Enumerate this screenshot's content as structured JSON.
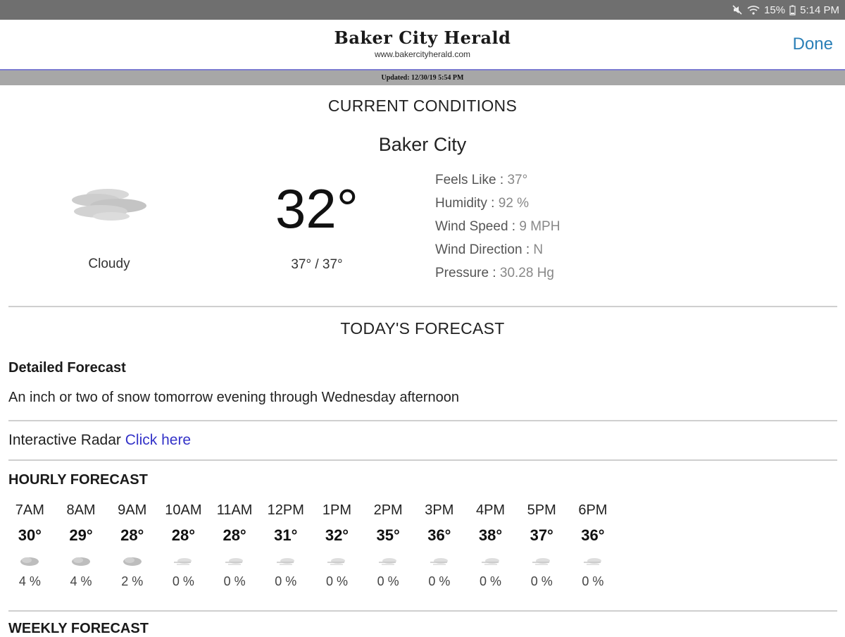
{
  "status_bar": {
    "battery": "15%",
    "time": "5:14 PM",
    "icons": [
      "mute-icon",
      "wifi-icon",
      "battery-icon"
    ]
  },
  "header": {
    "masthead": "Baker City Herald",
    "url": "www.bakercityherald.com",
    "done_label": "Done",
    "updated": "Updated: 12/30/19 5:54 PM"
  },
  "current": {
    "section_title": "CURRENT CONDITIONS",
    "city": "Baker City",
    "condition": "Cloudy",
    "condition_icon": "cloudy-icon",
    "temperature": "32°",
    "hi_lo": "37° / 37°",
    "details": [
      {
        "label": "Feels Like : ",
        "value": "37°"
      },
      {
        "label": "Humidity : ",
        "value": "92 %"
      },
      {
        "label": "Wind Speed : ",
        "value": "9 MPH"
      },
      {
        "label": "Wind Direction : ",
        "value": "N"
      },
      {
        "label": "Pressure : ",
        "value": "30.28 Hg"
      }
    ]
  },
  "today": {
    "section_title": "TODAY'S FORECAST",
    "detailed_label": "Detailed Forecast",
    "detailed_text": "An inch or two of snow tomorrow evening through Wednesday afternoon",
    "radar_label": "Interactive Radar ",
    "radar_link": "Click here"
  },
  "hourly": {
    "title": "HOURLY FORECAST",
    "hours": [
      {
        "time": "7AM",
        "temp": "30°",
        "pop": "4 %",
        "icon": "cloudy-icon"
      },
      {
        "time": "8AM",
        "temp": "29°",
        "pop": "4 %",
        "icon": "cloudy-icon"
      },
      {
        "time": "9AM",
        "temp": "28°",
        "pop": "2 %",
        "icon": "cloudy-icon"
      },
      {
        "time": "10AM",
        "temp": "28°",
        "pop": "0 %",
        "icon": "windy-cloud-icon"
      },
      {
        "time": "11AM",
        "temp": "28°",
        "pop": "0 %",
        "icon": "windy-cloud-icon"
      },
      {
        "time": "12PM",
        "temp": "31°",
        "pop": "0 %",
        "icon": "windy-cloud-icon"
      },
      {
        "time": "1PM",
        "temp": "32°",
        "pop": "0 %",
        "icon": "windy-cloud-icon"
      },
      {
        "time": "2PM",
        "temp": "35°",
        "pop": "0 %",
        "icon": "windy-cloud-icon"
      },
      {
        "time": "3PM",
        "temp": "36°",
        "pop": "0 %",
        "icon": "windy-cloud-icon"
      },
      {
        "time": "4PM",
        "temp": "38°",
        "pop": "0 %",
        "icon": "windy-cloud-icon"
      },
      {
        "time": "5PM",
        "temp": "37°",
        "pop": "0 %",
        "icon": "windy-cloud-icon"
      },
      {
        "time": "6PM",
        "temp": "36°",
        "pop": "0 %",
        "icon": "windy-cloud-icon"
      }
    ]
  },
  "weekly": {
    "title": "WEEKLY FORECAST"
  }
}
